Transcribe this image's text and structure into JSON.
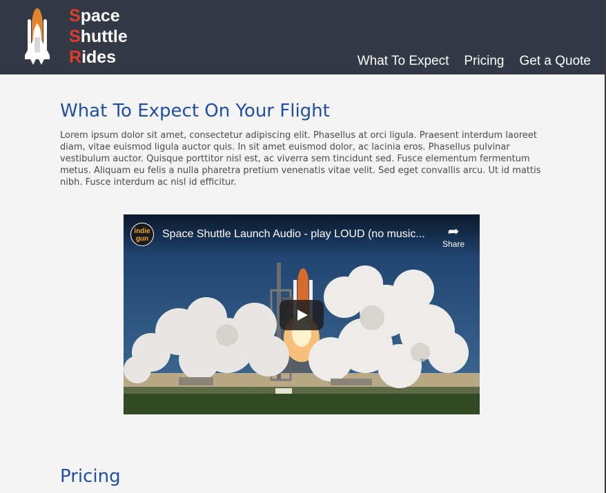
{
  "brand": {
    "line1_cap": "S",
    "line1_rest": "pace",
    "line2_cap": "S",
    "line2_rest": "huttle",
    "line3_cap": "R",
    "line3_rest": "ides"
  },
  "nav": {
    "items": [
      {
        "label": "What To Expect"
      },
      {
        "label": "Pricing"
      },
      {
        "label": "Get a Quote"
      }
    ]
  },
  "expect": {
    "title": "What To Expect On Your Flight",
    "body": "Lorem ipsum dolor sit amet, consectetur adipiscing elit. Phasellus at orci ligula. Praesent interdum laoreet diam, vitae euismod ligula auctor quis. In sit amet euismod dolor, ac lacinia eros. Phasellus pulvinar vestibulum auctor. Quisque porttitor nisl est, ac viverra sem tincidunt sed. Fusce elementum fermentum metus. Aliquam eu felis a nulla pharetra pretium venenatis vitae velit. Sed eget convallis arcu. Ut id mattis nibh. Fusce interdum ac nisl id efficitur."
  },
  "video": {
    "title": "Space Shuttle Launch Audio - play LOUD (no music...",
    "channel_line1": "indie",
    "channel_line2": "gun",
    "share_label": "Share",
    "share_icon": "share-arrow-icon",
    "play_icon": "play-icon"
  },
  "pricing": {
    "title": "Pricing"
  },
  "colors": {
    "header_bg": "#343a45",
    "brand_accent": "#e03a2a",
    "heading_blue": "#1f4fa0",
    "page_bg": "#f4f4f4"
  }
}
